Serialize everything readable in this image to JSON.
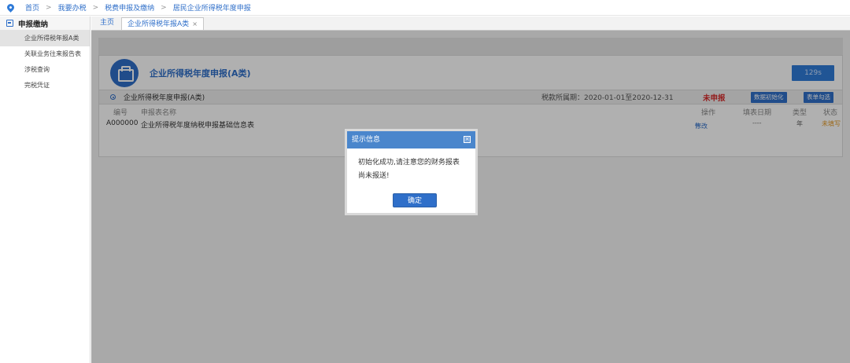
{
  "breadcrumb": [
    "首页",
    "我要办税",
    "税费申报及缴纳",
    "居民企业所得税年度申报"
  ],
  "breadcrumb_separator": ">",
  "sidebar": {
    "title": "申报缴纳",
    "items": [
      {
        "label": "企业所得税年报A类",
        "active": true
      },
      {
        "label": "关联业务往来报告表",
        "active": false
      },
      {
        "label": "涉税查询",
        "active": false
      },
      {
        "label": "完税凭证",
        "active": false
      }
    ]
  },
  "tabs": [
    {
      "label": "主页",
      "active": false,
      "closable": false
    },
    {
      "label": "企业所得税年报A类",
      "active": true,
      "closable": true,
      "close_glyph": "×"
    }
  ],
  "panel": {
    "title": "企业所得税年度申报(A类)",
    "countdown": "129s",
    "report_type": "企业所得税年度申报(A类)",
    "tax_period": "税款所属期：2020-01-01至2020-12-31",
    "filing_status": "未申报",
    "init_button": "数据初始化",
    "select_button": "表单勾选"
  },
  "table": {
    "headers": {
      "code": "编号",
      "name": "申报表名称",
      "action": "操作",
      "fill_date": "填表日期",
      "type": "类型",
      "status": "状态"
    },
    "rows": [
      {
        "code": "A000000",
        "name": "企业所得税年度纳税申报基础信息表",
        "action": "修改",
        "fill_date": "----",
        "type": "年",
        "status": "未填写"
      }
    ]
  },
  "modal": {
    "title": "提示信息",
    "close_glyph": "×",
    "message_line1": "初始化成功,请注意您的财务报表",
    "message_line2": "尚未报送!",
    "ok_button": "确定"
  },
  "colors": {
    "accent": "#2f6fc9",
    "status_red": "#d62b2b",
    "status_orange": "#e39a2a",
    "modal_header": "#4a86cc"
  }
}
